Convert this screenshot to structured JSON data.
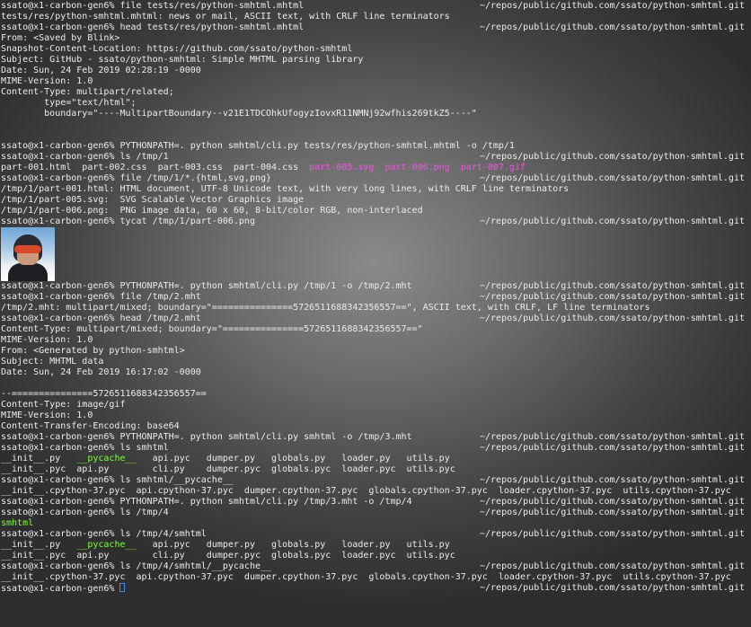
{
  "terminal": {
    "lines": [
      {
        "l": "ssato@x1-carbon-gen6% file tests/res/python-smhtml.mhtml",
        "r": "~/repos/public/github.com/ssato/python-smhtml.git"
      },
      {
        "l": "tests/res/python-smhtml.mhtml: news or mail, ASCII text, with CRLF line terminators",
        "r": ""
      },
      {
        "l": "ssato@x1-carbon-gen6% head tests/res/python-smhtml.mhtml",
        "r": "~/repos/public/github.com/ssato/python-smhtml.git"
      },
      {
        "l": "From: <Saved by Blink>",
        "r": ""
      },
      {
        "l": "Snapshot-Content-Location: https://github.com/ssato/python-smhtml",
        "r": ""
      },
      {
        "l": "Subject: GitHub - ssato/python-smhtml: Simple MHTML parsing library",
        "r": ""
      },
      {
        "l": "Date: Sun, 24 Feb 2019 02:28:19 -0000",
        "r": ""
      },
      {
        "l": "MIME-Version: 1.0",
        "r": ""
      },
      {
        "l": "Content-Type: multipart/related;",
        "r": ""
      },
      {
        "l": "        type=\"text/html\";",
        "r": ""
      },
      {
        "l": "        boundary=\"----MultipartBoundary--v21E1TDCOhkUfogyzIovxR11NMNj92wfhis269tkZ5----\"",
        "r": ""
      },
      {
        "l": "",
        "r": ""
      },
      {
        "l": "",
        "r": ""
      },
      {
        "l": "ssato@x1-carbon-gen6% PYTHONPATH=. python smhtml/cli.py tests/res/python-smhtml.mhtml -o /tmp/1",
        "r": ""
      },
      {
        "l": "ssato@x1-carbon-gen6% ls /tmp/1",
        "r": "~/repos/public/github.com/ssato/python-smhtml.git"
      },
      {
        "l": "part-001.html  part-002.css  part-003.css  part-004.css  ",
        "m": "part-005.svg  part-006.png  part-007.gif",
        "r": ""
      },
      {
        "l": "ssato@x1-carbon-gen6% file /tmp/1/*.{html,svg,png}",
        "r": "~/repos/public/github.com/ssato/python-smhtml.git"
      },
      {
        "l": "/tmp/1/part-001.html: HTML document, UTF-8 Unicode text, with very long lines, with CRLF line terminators",
        "r": ""
      },
      {
        "l": "/tmp/1/part-005.svg:  SVG Scalable Vector Graphics image",
        "r": ""
      },
      {
        "l": "/tmp/1/part-006.png:  PNG image data, 60 x 60, 8-bit/color RGB, non-interlaced",
        "r": ""
      },
      {
        "l": "ssato@x1-carbon-gen6% tycat /tmp/1/part-006.png",
        "r": "~/repos/public/github.com/ssato/python-smhtml.git"
      },
      {
        "l": "",
        "r": ""
      },
      {
        "l": "",
        "r": ""
      },
      {
        "l": "",
        "r": ""
      },
      {
        "l": "",
        "r": ""
      },
      {
        "l": "",
        "r": ""
      },
      {
        "l": "ssato@x1-carbon-gen6% PYTHONPATH=. python smhtml/cli.py /tmp/1 -o /tmp/2.mht",
        "r": "~/repos/public/github.com/ssato/python-smhtml.git"
      },
      {
        "l": "ssato@x1-carbon-gen6% file /tmp/2.mht",
        "r": "~/repos/public/github.com/ssato/python-smhtml.git"
      },
      {
        "l": "/tmp/2.mht: multipart/mixed; boundary=\"===============5726511688342356557==\", ASCII text, with CRLF, LF line terminators",
        "r": ""
      },
      {
        "l": "ssato@x1-carbon-gen6% head /tmp/2.mht",
        "r": "~/repos/public/github.com/ssato/python-smhtml.git"
      },
      {
        "l": "Content-Type: multipart/mixed; boundary=\"===============5726511688342356557==\"",
        "r": ""
      },
      {
        "l": "MIME-Version: 1.0",
        "r": ""
      },
      {
        "l": "From: <Generated by python-smhtml>",
        "r": ""
      },
      {
        "l": "Subject: MHTML data",
        "r": ""
      },
      {
        "l": "Date: Sun, 24 Feb 2019 16:17:02 -0000",
        "r": ""
      },
      {
        "l": "",
        "r": ""
      },
      {
        "l": "--===============5726511688342356557==",
        "r": ""
      },
      {
        "l": "Content-Type: image/gif",
        "r": ""
      },
      {
        "l": "MIME-Version: 1.0",
        "r": ""
      },
      {
        "l": "Content-Transfer-Encoding: base64",
        "r": ""
      },
      {
        "l": "ssato@x1-carbon-gen6% PYTHONPATH=. python smhtml/cli.py smhtml -o /tmp/3.mht",
        "r": "~/repos/public/github.com/ssato/python-smhtml.git"
      },
      {
        "l": "ssato@x1-carbon-gen6% ls smhtml",
        "r": "~/repos/public/github.com/ssato/python-smhtml.git"
      },
      {
        "l": "__init__.py   ",
        "g": "__pycache__",
        "l2": "   api.pyc   dumper.py   globals.py   loader.py   utils.py",
        "r": ""
      },
      {
        "l": "__init__.pyc  api.py        cli.py    dumper.pyc  globals.pyc  loader.pyc  utils.pyc",
        "r": ""
      },
      {
        "l": "ssato@x1-carbon-gen6% ls smhtml/__pycache__",
        "r": "~/repos/public/github.com/ssato/python-smhtml.git"
      },
      {
        "l": "__init__.cpython-37.pyc  api.cpython-37.pyc  dumper.cpython-37.pyc  globals.cpython-37.pyc  loader.cpython-37.pyc  utils.cpython-37.pyc",
        "r": ""
      },
      {
        "l": "ssato@x1-carbon-gen6% PYTHONPATH=. python smhtml/cli.py /tmp/3.mht -o /tmp/4",
        "r": "~/repos/public/github.com/ssato/python-smhtml.git"
      },
      {
        "l": "ssato@x1-carbon-gen6% ls /tmp/4",
        "r": "~/repos/public/github.com/ssato/python-smhtml.git"
      },
      {
        "l": "",
        "g": "smhtml",
        "r": ""
      },
      {
        "l": "ssato@x1-carbon-gen6% ls /tmp/4/smhtml",
        "r": "~/repos/public/github.com/ssato/python-smhtml.git"
      },
      {
        "l": "__init__.py   ",
        "g": "__pycache__",
        "l2": "   api.pyc   dumper.py   globals.py   loader.py   utils.py",
        "r": ""
      },
      {
        "l": "__init__.pyc  api.py        cli.py    dumper.pyc  globals.pyc  loader.pyc  utils.pyc",
        "r": ""
      },
      {
        "l": "ssato@x1-carbon-gen6% ls /tmp/4/smhtml/__pycache__",
        "r": "~/repos/public/github.com/ssato/python-smhtml.git"
      },
      {
        "l": "__init__.cpython-37.pyc  api.cpython-37.pyc  dumper.cpython-37.pyc  globals.cpython-37.pyc  loader.cpython-37.pyc  utils.cpython-37.pyc",
        "r": ""
      },
      {
        "l": "ssato@x1-carbon-gen6% ",
        "cursor": true,
        "r": "~/repos/public/github.com/ssato/python-smhtml.git"
      }
    ]
  },
  "image": {
    "icon": "thumbnail-photo"
  }
}
